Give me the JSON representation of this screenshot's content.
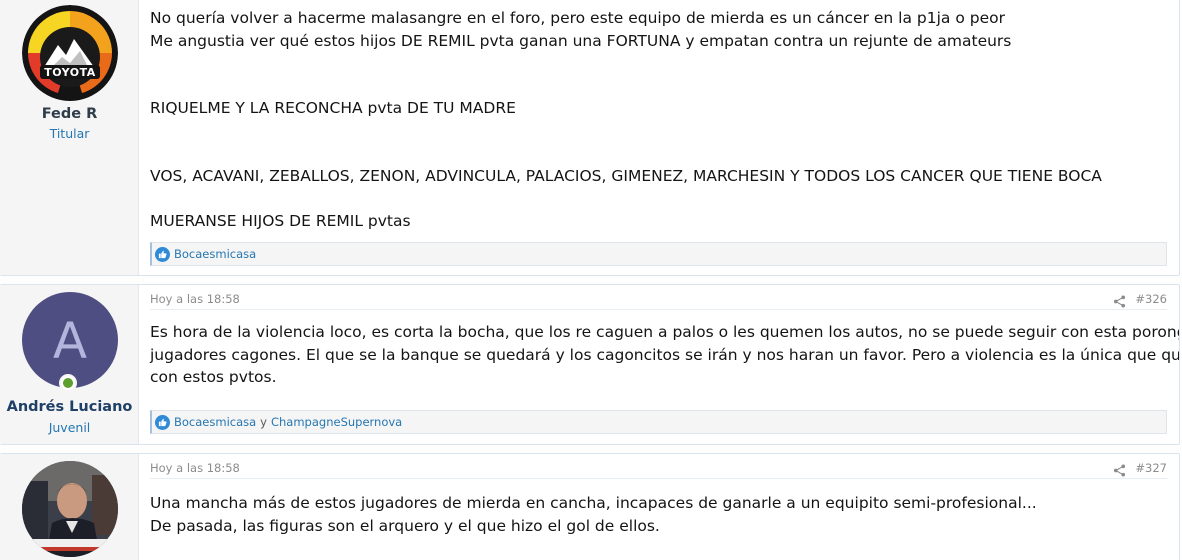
{
  "posts": [
    {
      "author": "Fede R",
      "user_title": "Titular",
      "avatar_text": "TOYOTA",
      "lines": [
        "No quería volver a hacerme malasangre en el foro, pero este equipo de mierda es un cáncer en la p1ja o peor",
        "Me angustia ver qué estos hijos DE REMIL pvta ganan una FORTUNA y empatan contra un rejunte de amateurs",
        "RIQUELME Y LA RECONCHA pvta DE TU MADRE",
        "VOS, ACAVANI, ZEBALLOS, ZENON, ADVINCULA, PALACIOS, GIMENEZ, MARCHESIN Y TODOS LOS CANCER QUE TIENE BOCA",
        "MUERANSE HIJOS DE REMIL pvtas"
      ],
      "reactions": "Bocaesmicasa"
    },
    {
      "author": "Andrés Luciano",
      "user_title": "Juvenil",
      "avatar_letter": "A",
      "avatar_color": "#4e4e82",
      "time": "Hoy a las 18:58",
      "number": "#326",
      "lines": [
        "Es hora de la violencia loco, es corta la bocha, que los re caguen a palos o les quemen los autos, no se puede seguir con esta poronga de",
        "jugadores cagones. El que se la banque se quedará y los cagoncitos se irán y nos haran un favor. Pero a violencia es la única que queda",
        "con estos pvtos."
      ],
      "reactions": {
        "first": "Bocaesmicasa",
        "conj": "y",
        "second": "ChampagneSupernova"
      }
    },
    {
      "time": "Hoy a las 18:58",
      "number": "#327",
      "lines": [
        "Una mancha más de estos jugadores de mierda en cancha, incapaces de ganarle a un equipito semi-profesional...",
        "De pasada, las figuras son el arquero y el que hizo el gol de ellos."
      ]
    }
  ],
  "colors": {
    "accent": "#2577b1",
    "online": "#5c9f2f",
    "like": "#2f8ad8"
  }
}
